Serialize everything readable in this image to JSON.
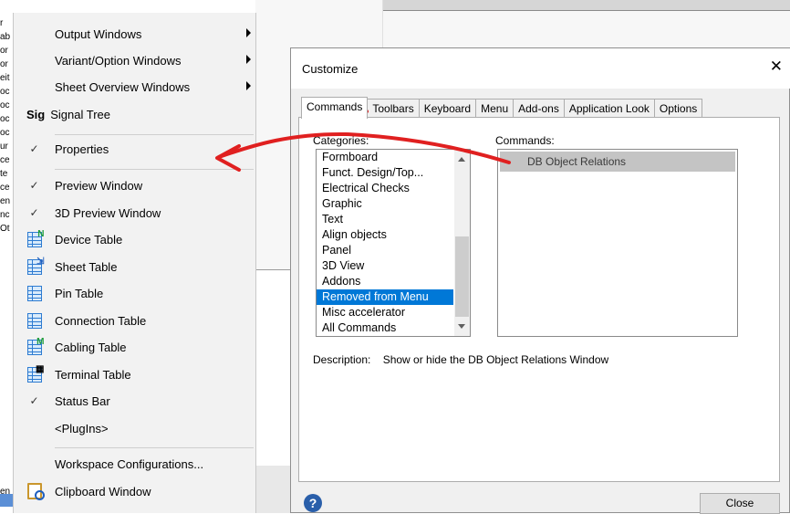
{
  "background": {
    "strip_lines": [
      "r",
      "ab",
      "or",
      "or",
      "eit",
      "oc",
      "oc",
      "oc",
      "oc",
      "ur",
      "ce",
      "te",
      "ce",
      "en",
      "nc",
      "Ot"
    ],
    "strip_bottom": "en"
  },
  "menu": {
    "items": [
      {
        "label": "Output Windows",
        "submenu": true
      },
      {
        "label": "Variant/Option Windows",
        "submenu": true
      },
      {
        "label": "Sheet Overview Windows",
        "submenu": true
      },
      {
        "label": "Signal Tree",
        "icon_text": "Sig"
      },
      {
        "label": "Properties",
        "checked": true
      },
      {
        "label": "Preview Window",
        "checked": true
      },
      {
        "label": "3D Preview Window",
        "checked": true
      },
      {
        "label": "Device Table",
        "icon": "device-table-icon",
        "overlay": "N"
      },
      {
        "label": "Sheet Table",
        "icon": "sheet-table-icon",
        "overlay": "⇲"
      },
      {
        "label": "Pin Table",
        "icon": "pin-table-icon"
      },
      {
        "label": "Connection Table",
        "icon": "connection-table-icon"
      },
      {
        "label": "Cabling Table",
        "icon": "cabling-table-icon",
        "overlay": "M"
      },
      {
        "label": "Terminal Table",
        "icon": "terminal-table-icon",
        "overlay": "▦"
      },
      {
        "label": "Status Bar",
        "checked": true
      },
      {
        "label": "<PlugIns>"
      },
      {
        "label": "Workspace Configurations..."
      },
      {
        "label": "Clipboard Window",
        "icon": "clipboard-icon"
      }
    ],
    "check_glyph": "✓"
  },
  "dialog": {
    "title": "Customize",
    "close_glyph": "✕",
    "tabs": [
      "Commands",
      "Toolbars",
      "Keyboard",
      "Menu",
      "Add-ons",
      "Application Look",
      "Options"
    ],
    "active_tab": "Commands",
    "categories_label": "Categories:",
    "commands_label": "Commands:",
    "categories": [
      "Formboard",
      "Funct. Design/Top...",
      "Electrical Checks",
      "Graphic",
      "Text",
      "Align objects",
      "Panel",
      "3D View",
      "Addons",
      "Removed from Menu",
      "Misc accelerator",
      "All Commands"
    ],
    "selected_category": "Removed from Menu",
    "commands": [
      "DB Object Relations"
    ],
    "description_label": "Description:",
    "description_value": "Show or hide the DB Object Relations Window",
    "help_glyph": "?",
    "close_button": "Close"
  },
  "colors": {
    "annotation_red": "#e02020",
    "selection_blue": "#0078d7",
    "command_highlight": "#c4c4c4"
  }
}
